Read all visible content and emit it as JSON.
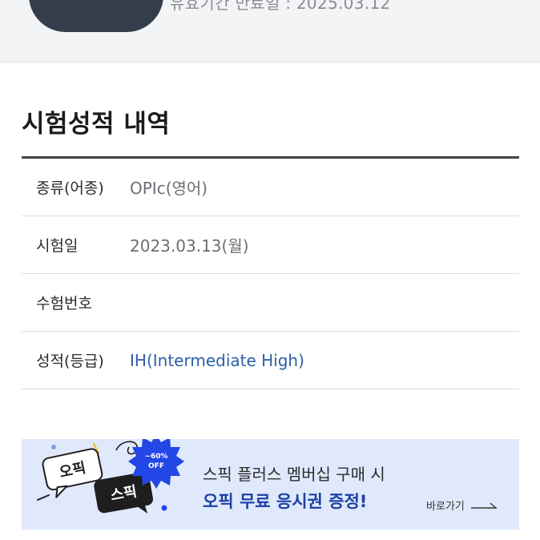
{
  "header": {
    "expiry_text": "유효기간 만료일 : 2025.03.12"
  },
  "section": {
    "title": "시험성적 내역"
  },
  "score_table": {
    "rows": [
      {
        "label": "종류(어종)",
        "value": "OPIc(영어)"
      },
      {
        "label": "시험일",
        "value": "2023.03.13(월)"
      },
      {
        "label": "수험번호",
        "value": ""
      },
      {
        "label": "성적(등급)",
        "value": "IH(Intermediate High)"
      }
    ]
  },
  "banner": {
    "badge_opic": "오픽",
    "badge_speak": "스픽",
    "discount_line1": "~60%",
    "discount_line2": "OFF",
    "line1": "스픽 플러스 멤버십 구매 시",
    "line2": "오픽 무료 응시권 증정!",
    "link_label": "바로가기",
    "colors": {
      "background": "#dfe9fb",
      "accent": "#1d3fa6",
      "badge_dark": "#1e1e1e",
      "discount": "#2346e6"
    }
  }
}
